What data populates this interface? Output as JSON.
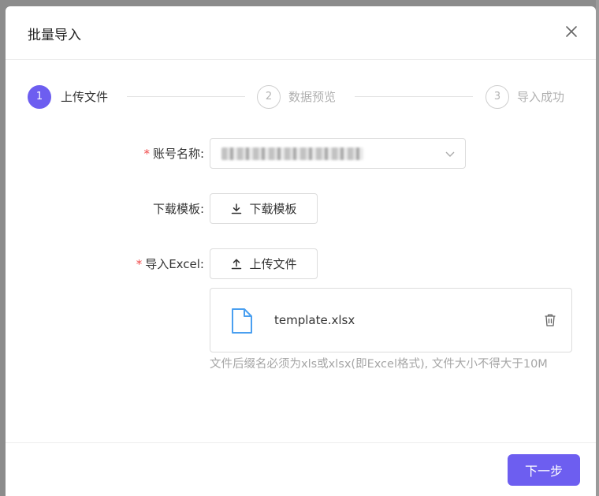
{
  "dialog": {
    "title": "批量导入",
    "close_icon": "close-icon"
  },
  "steps": [
    {
      "number": "1",
      "label": "上传文件",
      "state": "active"
    },
    {
      "number": "2",
      "label": "数据预览",
      "state": "inactive"
    },
    {
      "number": "3",
      "label": "导入成功",
      "state": "inactive"
    }
  ],
  "form": {
    "account": {
      "label": "账号名称:",
      "required": "*",
      "value_blurred": true
    },
    "template": {
      "label": "下载模板:",
      "button_label": "下载模板",
      "icon": "download-icon"
    },
    "import": {
      "label": "导入Excel:",
      "required": "*",
      "button_label": "上传文件",
      "icon": "upload-icon"
    },
    "file": {
      "name": "template.xlsx",
      "icon": "file-icon",
      "delete_icon": "trash-icon"
    },
    "hint": "文件后缀名必须为xls或xlsx(即Excel格式), 文件大小不得大于10M"
  },
  "footer": {
    "next_label": "下一步"
  },
  "colors": {
    "primary": "#6d5ef0",
    "required": "#f04848",
    "file_icon": "#4a9ff0"
  }
}
